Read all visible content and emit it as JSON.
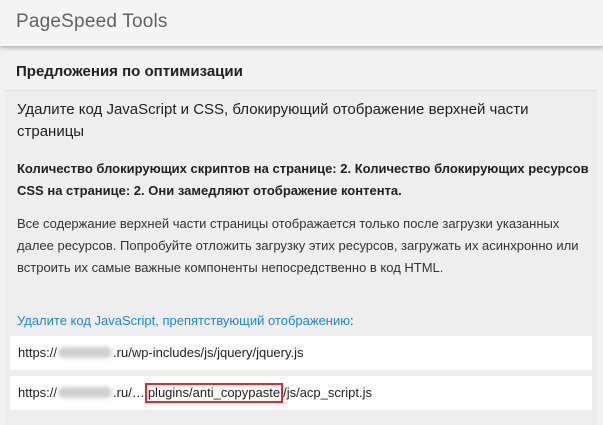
{
  "app": {
    "title": "PageSpeed Tools"
  },
  "section": {
    "title": "Предложения по оптимизации"
  },
  "rule": {
    "title": "Удалите код JavaScript и CSS, блокирующий отображение верхней части страницы",
    "summary": "Количество блокирующих скриптов на странице: 2. Количество блокирующих ресурсов CSS на странице: 2. Они замедляют отображение контента.",
    "body": "Все содержание верхней части страницы отображается только после загрузки указанных далее ресурсов. Попробуйте отложить загрузку этих ресурсов, загружать их асинхронно или встроить их самые важные компоненты непосредственно в код HTML.",
    "link_text": "Удалите код JavaScript, препятствующий отображению",
    "link_suffix": ":"
  },
  "urls": [
    {
      "prefix": "https://",
      "domain_suffix": ".ru/wp-includes/js/jquery/jquery.js"
    },
    {
      "prefix": "https://",
      "domain_suffix": ".ru/…",
      "highlighted": "plugins/anti_copypaste",
      "tail": "/js/acp_script.js"
    }
  ],
  "colors": {
    "link": "#1e88c9",
    "highlight_border": "#e32b2b"
  }
}
